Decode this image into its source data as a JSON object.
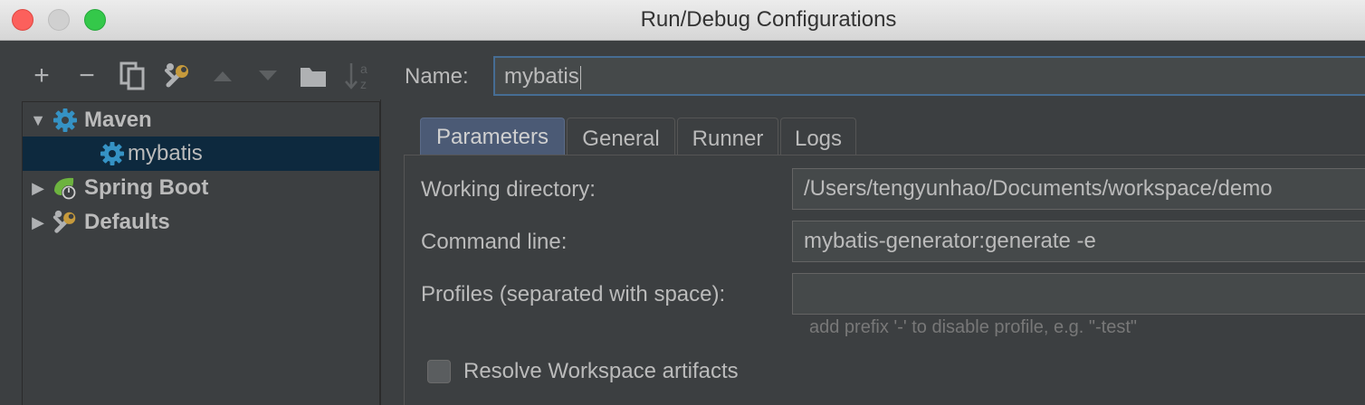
{
  "window": {
    "title": "Run/Debug Configurations"
  },
  "toolbar": {
    "add": "+",
    "remove": "−",
    "sort_top": "a",
    "sort_bottom": "z"
  },
  "tree": {
    "items": [
      {
        "label": "Maven",
        "expanded": true,
        "icon": "gear-icon"
      },
      {
        "label": "mybatis",
        "selected": true,
        "icon": "gear-icon"
      },
      {
        "label": "Spring Boot",
        "expanded": false,
        "icon": "spring-boot-icon"
      },
      {
        "label": "Defaults",
        "expanded": false,
        "icon": "wrench-icon"
      }
    ]
  },
  "form": {
    "name_label": "Name:",
    "name_value": "mybatis"
  },
  "tabs": [
    {
      "label": "Parameters",
      "active": true
    },
    {
      "label": "General"
    },
    {
      "label": "Runner"
    },
    {
      "label": "Logs"
    }
  ],
  "parameters": {
    "working_dir_label": "Working directory:",
    "working_dir_value": "/Users/tengyunhao/Documents/workspace/demo",
    "command_line_label": "Command line:",
    "command_line_value": "mybatis-generator:generate -e",
    "profiles_label": "Profiles (separated with space):",
    "profiles_value": "",
    "profiles_hint": "add prefix '-' to disable profile, e.g. \"-test\"",
    "resolve_label": "Resolve Workspace artifacts",
    "resolve_checked": false
  },
  "colors": {
    "selection": "#0d293e",
    "gear_blue": "#3592c4",
    "spring_green": "#6db33f",
    "active_tab": "#4b5a75"
  }
}
